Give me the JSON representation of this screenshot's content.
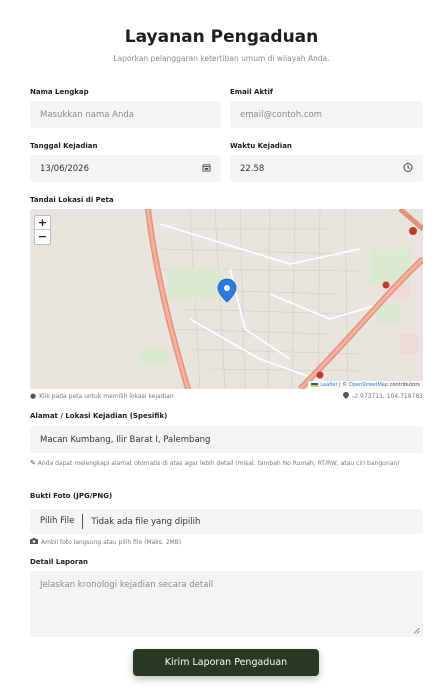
{
  "header": {
    "title": "Layanan Pengaduan",
    "subtitle": "Laporkan pelanggaran ketertiban umum di wilayah Anda."
  },
  "form": {
    "name": {
      "label": "Nama Lengkap",
      "placeholder": "Masukkan nama Anda"
    },
    "email": {
      "label": "Email Aktif",
      "placeholder": "email@contoh.com"
    },
    "date": {
      "label": "Tanggal Kejadian",
      "value": "13/06/2026",
      "icon": "calendar-icon"
    },
    "time": {
      "label": "Waktu Kejadian",
      "value": "22.58",
      "icon": "clock-icon"
    },
    "map": {
      "label": "Tandai Lokasi di Peta",
      "zoom_in": "+",
      "zoom_out": "−",
      "attribution_leaflet": "Leaflet",
      "attribution_sep": " | © ",
      "attribution_osm": "OpenStreetMap",
      "attribution_suffix": " contributors",
      "hint": "Klik pada peta untuk memilih lokasi kejadian",
      "coords": "-2.973711, 104.718783"
    },
    "address": {
      "label": "Alamat / Lokasi Kejadian (Spesifik)",
      "value": "Macan Kumbang, Ilir Barat I, Palembang",
      "hint": "Anda dapat melengkapi alamat otomatis di atas agar lebih detail (misal: tambah No Rumah, RT/RW, atau ciri bangunan)"
    },
    "photo": {
      "label": "Bukti Foto (JPG/PNG)",
      "button": "Pilih File",
      "status": "Tidak ada file yang dipilih",
      "hint": "Ambil foto langsung atau pilih file (Maks. 2MB)"
    },
    "details": {
      "label": "Detail Laporan",
      "placeholder": "Jelaskan kronologi kejadian secara detail"
    },
    "submit_label": "Kirim Laporan Pengaduan"
  },
  "colors": {
    "accent": "#2a3722",
    "field_bg": "#f3f4f4",
    "road": "#e8907a",
    "marker": "#2a7ae2"
  }
}
